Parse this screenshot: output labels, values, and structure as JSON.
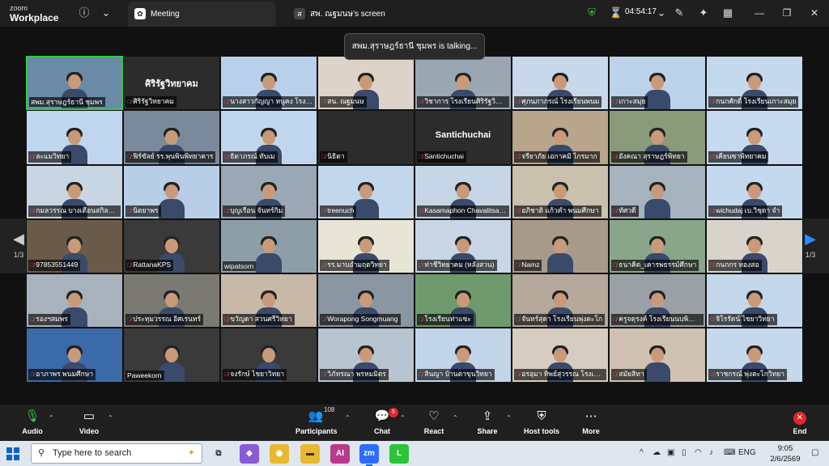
{
  "app": {
    "brand_line1": "zoom",
    "brand_line2": "Workplace"
  },
  "tabs": [
    {
      "label": "Meeting",
      "active": true
    },
    {
      "label": "สพ. ณฐมนษ's screen",
      "active": false
    }
  ],
  "header": {
    "timer": "04:54:17"
  },
  "talking_banner": "สพม.สุราษฎร์ธานี ชุมพร is talking...",
  "pager": {
    "left": "1/3",
    "right": "1/3"
  },
  "participants": [
    {
      "name": "สพม.สุราษฎร์ธานี ชุมพร",
      "muted": false,
      "active": true,
      "bg": "#6a8aa8",
      "video": true
    },
    {
      "name": "ศิริรัฐวิทยาคม",
      "muted": true,
      "bg": "#2c2c2c",
      "video": false,
      "big": "ศิริรัฐวิทยาคม"
    },
    {
      "name": "นางสาวกัญญา หนูคง โรงเรียน",
      "muted": true,
      "bg": "#b9d0ea",
      "video": true
    },
    {
      "name": "สน. ณฐมนษ",
      "muted": true,
      "bg": "#ddd3c8",
      "video": true
    },
    {
      "name": "วิชาการ โรงเรียนศิริรัฐวิทยาคม",
      "muted": true,
      "bg": "#9aa6b2",
      "video": true
    },
    {
      "name": "ศุภนภาภรณ์ โรงเรียนพนม",
      "muted": true,
      "bg": "#c8d8ea",
      "video": true
    },
    {
      "name": "เกาะสมุย",
      "muted": true,
      "bg": "#bcd2ea",
      "video": true
    },
    {
      "name": "กนกศักดิ์ โรงเรียนเกาะสมุย",
      "muted": true,
      "bg": "#c4d8ee",
      "video": true
    },
    {
      "name": "ละแมวิทยา",
      "muted": true,
      "bg": "#c0d6ee",
      "video": true
    },
    {
      "name": "ฟิร์ซัลย์ รร.พุนพินพิทยาคาร",
      "muted": true,
      "bg": "#7a8a9a",
      "video": true
    },
    {
      "name": "ธิดาภรณ์ ทับเม",
      "muted": true,
      "bg": "#c0d6ee",
      "video": true
    },
    {
      "name": "นิธิดา",
      "muted": true,
      "bg": "#2c2c2c",
      "video": false
    },
    {
      "name": "Santichuchai",
      "muted": true,
      "bg": "#2c2c2c",
      "video": false,
      "big": "Santichuchai"
    },
    {
      "name": "จรียาภัย เอกาคมิ ไกรมาก",
      "muted": true,
      "bg": "#b7a58c",
      "video": true
    },
    {
      "name": "อังคณา สุราษฎร์พิทยา",
      "muted": true,
      "bg": "#8a9a7a",
      "video": true
    },
    {
      "name": "เคียนซาพิทยาคม",
      "muted": true,
      "bg": "#c6d9ef",
      "video": true
    },
    {
      "name": "กมลวรรณ บางเดือนสกิลนิวิทยา",
      "muted": true,
      "bg": "#c8d6e4",
      "video": true
    },
    {
      "name": "นิตยาพร",
      "muted": true,
      "bg": "#b8cde6",
      "video": true
    },
    {
      "name": "บุญเรือน จันทร์กิม",
      "muted": true,
      "bg": "#9aa8b6",
      "video": true
    },
    {
      "name": "treenuch",
      "muted": true,
      "bg": "#c2d6ec",
      "video": true
    },
    {
      "name": "Kasamaphon Chavalitsawat",
      "muted": true,
      "bg": "#c6d6e6",
      "video": true
    },
    {
      "name": "อภิชาติ แก้วคำ พนมศึกษา",
      "muted": true,
      "bg": "#c9c0ae",
      "video": true
    },
    {
      "name": "ทัศวดี",
      "muted": true,
      "bg": "#a6b2be",
      "video": true
    },
    {
      "name": "wichudaj เบ.วิชุดา จำ",
      "muted": true,
      "bg": "#c4d8ee",
      "video": true
    },
    {
      "name": "97853551449",
      "muted": true,
      "bg": "#6a5a4a",
      "video": true
    },
    {
      "name": "RattanaKPS",
      "muted": true,
      "bg": "#3a3a3a",
      "video": true
    },
    {
      "name": "wipatsorn",
      "muted": false,
      "bg": "#8e9ea8",
      "video": true
    },
    {
      "name": "รร.มาบอำมฤตวิทยา",
      "muted": true,
      "bg": "#e8e4d6",
      "video": true
    },
    {
      "name": "ท่าชีวิทยาคม (หลังสวน)",
      "muted": true,
      "bg": "#c8d6e6",
      "video": true
    },
    {
      "name": "Namz",
      "muted": true,
      "bg": "#a89a8a",
      "video": true
    },
    {
      "name": "ธนาคิต_เคารพธรรม์ศึกษา",
      "muted": true,
      "bg": "#8aa68a",
      "video": true
    },
    {
      "name": "กนกกร ทองสอ",
      "muted": true,
      "bg": "#d8d4cc",
      "video": true
    },
    {
      "name": "รองฯสมพร",
      "muted": true,
      "bg": "#a8b2bc",
      "video": true
    },
    {
      "name": "ประทุมวรรณ อิศเรนทร์",
      "muted": true,
      "bg": "#7a7a72",
      "video": true
    },
    {
      "name": "ขวัญดา สวนศรีวิทยา",
      "muted": true,
      "bg": "#c8b8a8",
      "video": true
    },
    {
      "name": "Worapong Songmuang",
      "muted": true,
      "bg": "#8a96a2",
      "video": true
    },
    {
      "name": "โรงเรียนท่าแซะ",
      "muted": true,
      "bg": "#6e9a6e",
      "video": true
    },
    {
      "name": "จันทร์สุดา โรงเรียนพุ่งตะโก",
      "muted": true,
      "bg": "#b6a89a",
      "video": true
    },
    {
      "name": "ครูจตุรงค์ โรงเรียนนบพิตำวิทยา",
      "muted": true,
      "bg": "#9aa0a6",
      "video": true
    },
    {
      "name": "จิโรรัตน์ ไชยาวิทยา",
      "muted": true,
      "bg": "#c4d6ea",
      "video": true
    },
    {
      "name": "อาภาพร พนมศึกษา",
      "muted": true,
      "bg": "#3a6aa8",
      "video": true
    },
    {
      "name": "Paweekorn",
      "muted": false,
      "bg": "#3a3a3a",
      "video": true
    },
    {
      "name": "จงรักษ์ ไชยาวิทยา",
      "muted": true,
      "bg": "#3a3a3a",
      "video": true
    },
    {
      "name": "วิภัทรณา พรหมมิตร",
      "muted": true,
      "bg": "#b8c4d0",
      "video": true
    },
    {
      "name": "สินญา บ้านตาขุนวิทยา",
      "muted": true,
      "bg": "#c2d4e8",
      "video": true
    },
    {
      "name": "อรอุมา ทิพย์สุวรรณ โรงเรียน",
      "muted": true,
      "bg": "#d6ccc0",
      "video": true
    },
    {
      "name": "สมัยสิทา",
      "muted": true,
      "bg": "#cfc2b2",
      "video": true
    },
    {
      "name": "ราชกรณ์ พุ่งตะโกวิทยา",
      "muted": true,
      "bg": "#c6d8ec",
      "video": true
    }
  ],
  "toolbar": {
    "audio": "Audio",
    "video": "Video",
    "participants": "Participants",
    "participants_count": "108",
    "chat": "Chat",
    "chat_badge": "5",
    "react": "React",
    "share": "Share",
    "host_tools": "Host tools",
    "more": "More",
    "end": "End"
  },
  "taskbar": {
    "search_placeholder": "Type here to search",
    "lang": "ENG",
    "time": "9:05",
    "date": "2/6/2569"
  },
  "icons": {
    "security": "shield-icon",
    "timer": "hourglass-icon"
  },
  "colors": {
    "accent": "#2d8cff",
    "end": "#e02828",
    "active_speaker": "#35c94a"
  }
}
